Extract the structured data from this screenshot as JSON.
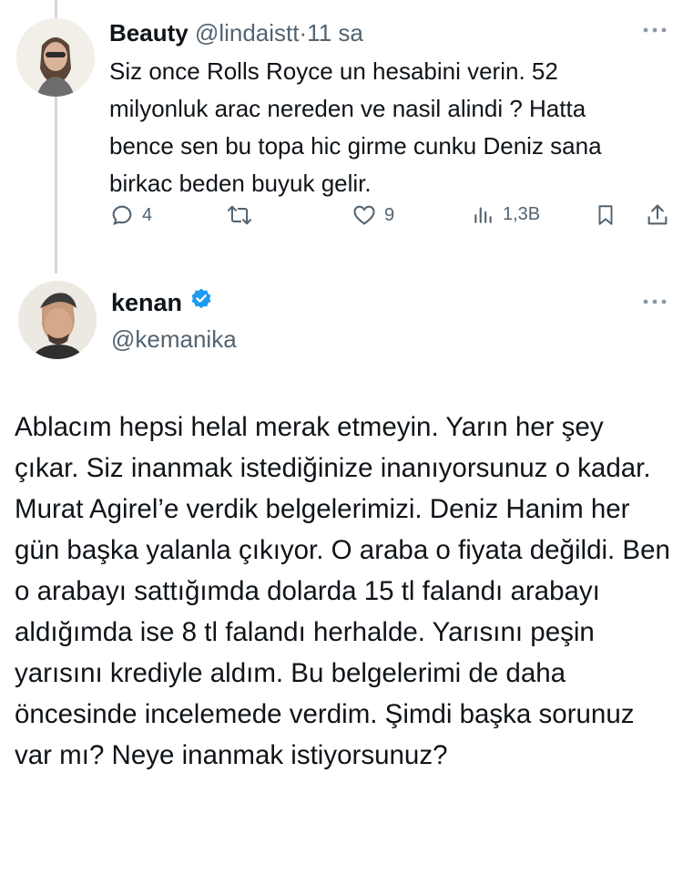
{
  "reply": {
    "display_name": "Beauty",
    "handle": "@lindaistt",
    "separator": "·",
    "time": "11 sa",
    "text": "Siz once Rolls Royce un hesabini verin. 52 milyonluk arac nereden ve nasil alindi ? Hatta bence sen bu topa hic girme cunku Deniz sana birkac beden buyuk gelir.",
    "stats": {
      "replies": "4",
      "likes": "9",
      "views": "1,3B"
    }
  },
  "main_post": {
    "display_name": "kenan",
    "handle": "@kemanika",
    "verified": true,
    "text": "Ablacım hepsi helal merak etmeyin. Yarın her şey çıkar. Siz inanmak istediğinize inanıyorsunuz o kadar. Murat Agirel’e verdik belgelerimizi. Deniz  Hanim her gün başka yalanla çıkıyor. O araba o fiyata değildi. Ben o arabayı sattığımda dolarda 15 tl falandı arabayı aldığımda ise 8 tl falandı herhalde. Yarısını peşin yarısını krediyle aldım. Bu belgelerimi de daha öncesinde incelemede verdim. Şimdi başka sorunuz var mı? Neye inanmak istiyorsunuz?"
  },
  "colors": {
    "text": "#0f1419",
    "muted": "#536471",
    "verified": "#1d9bf0",
    "thread_line": "#cfd9de"
  },
  "icons": [
    "reply-icon",
    "retweet-icon",
    "like-icon",
    "views-icon",
    "bookmark-icon",
    "share-icon",
    "more-icon",
    "verified-badge-icon"
  ]
}
